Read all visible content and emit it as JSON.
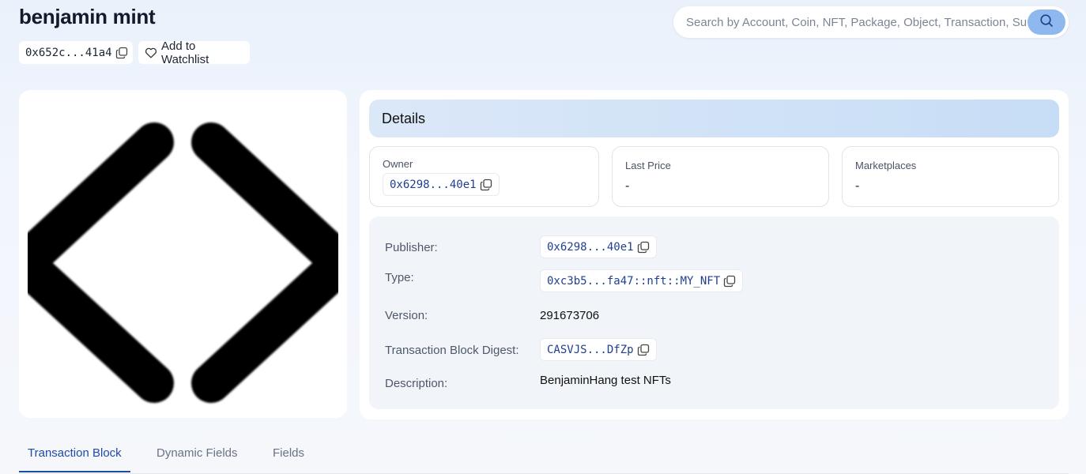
{
  "object": {
    "title": "benjamin mint",
    "address": "0x652c...41a4",
    "watchlist_label": "Add to Watchlist"
  },
  "search": {
    "placeholder": "Search by Account, Coin, NFT, Package, Object, Transaction, SuiNS"
  },
  "details": {
    "header": "Details",
    "owner": {
      "label": "Owner",
      "value": "0x6298...40e1"
    },
    "last_price": {
      "label": "Last Price",
      "value": "-"
    },
    "marketplaces": {
      "label": "Marketplaces",
      "value": "-"
    },
    "rows": {
      "publisher": {
        "label": "Publisher:",
        "value": "0x6298...40e1"
      },
      "type": {
        "label": "Type:",
        "value": "0xc3b5...fa47::nft::MY_NFT"
      },
      "version": {
        "label": "Version:",
        "value": "291673706"
      },
      "digest": {
        "label": "Transaction Block Digest:",
        "value": "CASVJS...DfZp"
      },
      "description": {
        "label": "Description:",
        "value": "BenjaminHang test NFTs"
      }
    }
  },
  "tabs": [
    {
      "label": "Transaction Block",
      "active": true
    },
    {
      "label": "Dynamic Fields",
      "active": false
    },
    {
      "label": "Fields",
      "active": false
    }
  ],
  "colors": {
    "accent": "#1f4aa8",
    "search_button": "#8fb9ee",
    "header_gradient": "#c7ddf6"
  },
  "icons": {
    "copy": "copy-icon",
    "heart": "heart-icon",
    "search": "search-icon",
    "nft_image": "diamond-brackets-image"
  }
}
